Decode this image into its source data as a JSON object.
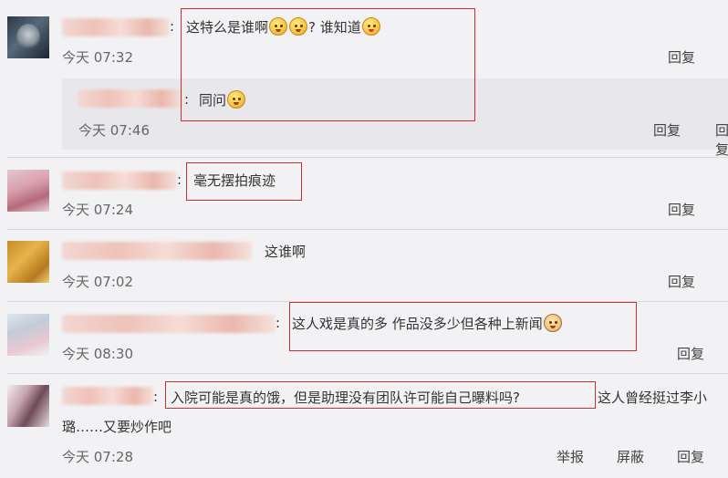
{
  "comments": [
    {
      "text_before": "这特么是谁啊",
      "text_middle": "? 谁知道",
      "time": "今天 07:32",
      "actions": [
        "回复"
      ],
      "reply": {
        "text": "同问",
        "time": "今天 07:46",
        "actions": [
          "回复"
        ]
      }
    },
    {
      "text": "毫无摆拍痕迹",
      "time": "今天 07:24",
      "actions": [
        "回复"
      ]
    },
    {
      "text": "这谁啊",
      "time": "今天 07:02",
      "actions": [
        "回复"
      ]
    },
    {
      "text": "这人戏是真的多  作品没多少但各种上新闻",
      "time": "今天 08:30",
      "actions": [
        "回复"
      ]
    },
    {
      "text_highlight": "入院可能是真的饿，但是助理没有团队许可能自己曝料吗?",
      "text_rest": "这人曾经挺过李小",
      "text_line2": "璐……又要炒作吧",
      "time": "今天 07:28",
      "actions": [
        "举报",
        "屏蔽",
        "回复"
      ]
    }
  ],
  "punctuation": {
    "colon": ":"
  },
  "icons": {
    "emoji_1": "confused-face-icon",
    "emoji_2": "thinking-heart-face-icon",
    "emoji_3": "thinking-face-icon",
    "emoji_4": "doge-icon"
  },
  "colors": {
    "highlight_border": "#c9302c",
    "background": "#f2f2f5",
    "reply_box": "#e8e8ec"
  }
}
